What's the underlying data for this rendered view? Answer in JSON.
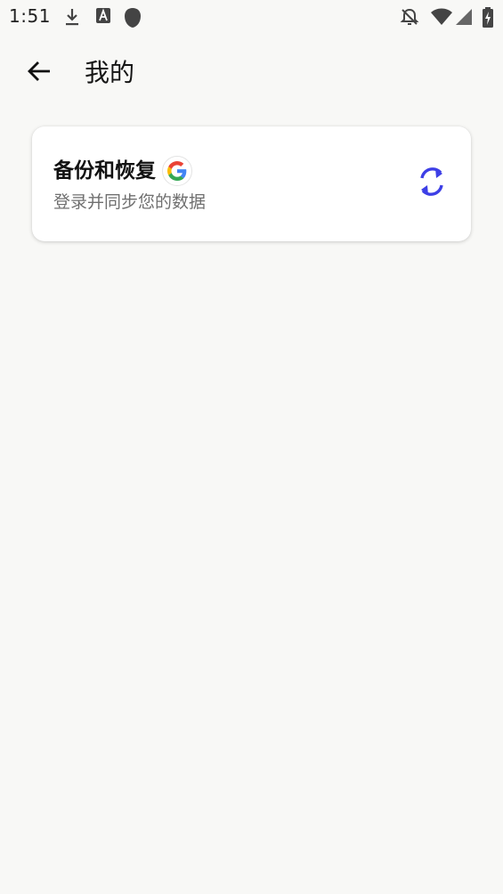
{
  "status_bar": {
    "time": "1:51",
    "icons": [
      "download-icon",
      "a-notification-icon",
      "shield-icon",
      "bell-off-icon",
      "wifi-icon",
      "signal-icon",
      "battery-charging-icon"
    ]
  },
  "app_bar": {
    "title": "我的",
    "back_icon": "arrow-left-icon"
  },
  "backup_card": {
    "title": "备份和恢复",
    "subtitle": "登录并同步您的数据",
    "badge_icon": "google-logo-icon",
    "action_icon": "sync-icon"
  },
  "colors": {
    "background": "#f8f8f6",
    "card": "#ffffff",
    "accent": "#3d3fe6",
    "subtitle": "#6f6f6f"
  }
}
